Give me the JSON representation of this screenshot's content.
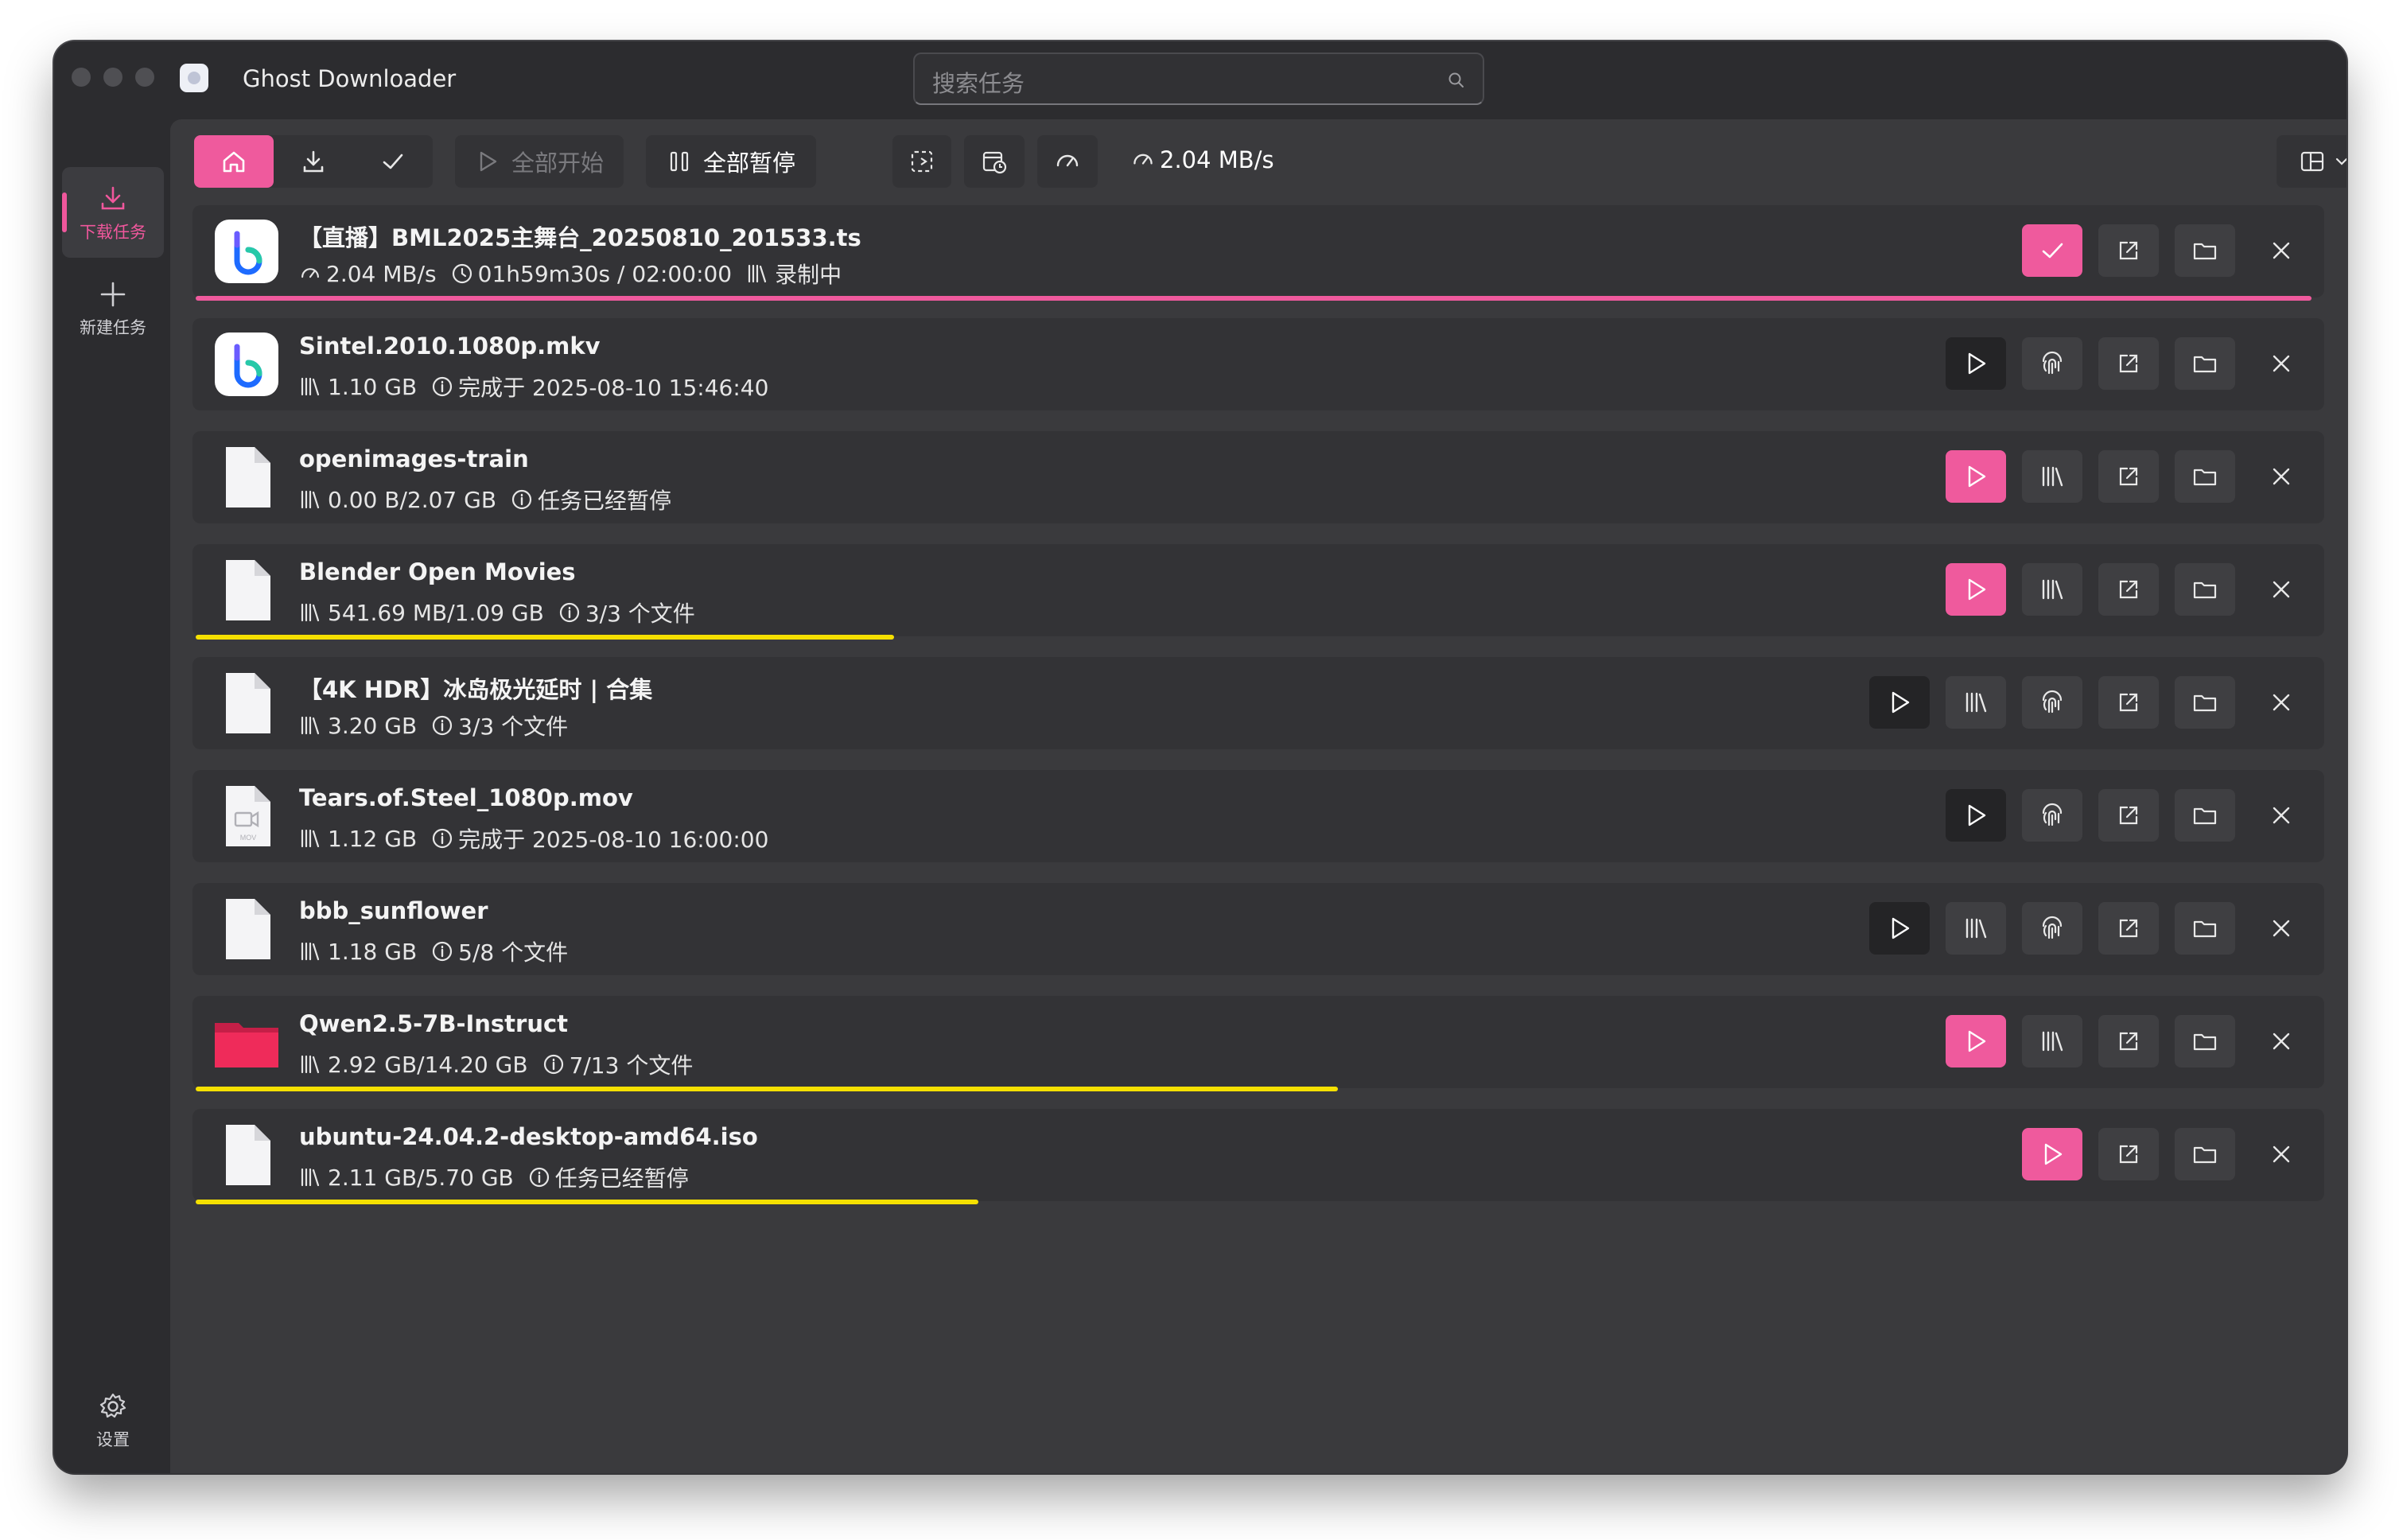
{
  "window": {
    "title": "Ghost Downloader"
  },
  "search": {
    "placeholder": "搜索任务"
  },
  "sidebar": {
    "items": [
      {
        "label": "下载任务",
        "icon": "download-icon",
        "active": true
      },
      {
        "label": "新建任务",
        "icon": "plus-icon",
        "active": false
      }
    ],
    "settings_label": "设置"
  },
  "toolbar": {
    "filters": [
      "all-home-icon",
      "downloading-icon",
      "finished-check-icon"
    ],
    "start_all_label": "全部开始",
    "pause_all_label": "全部暂停",
    "speed": "2.04 MB/s"
  },
  "colors": {
    "accent": "#ef5a9d",
    "progress_yellow": "#f5e000",
    "progress_pink": "#ef5a9d"
  },
  "tasks": [
    {
      "name": "【直播】BML2025主舞台_20250810_201533.ts",
      "icon": "bilibili-icon",
      "meta": [
        "2.04 MB/s",
        "01h59m30s / 02:00:00",
        "录制中"
      ],
      "progress": 1.0,
      "bar": "pink"
    },
    {
      "name": "Sintel.2010.1080p.mkv",
      "icon": "bilibili-icon",
      "meta": [
        "1.10 GB",
        "完成于 2025-08-10 15:46:40"
      ],
      "progress": null
    },
    {
      "name": "openimages-train",
      "icon": "file-icon",
      "meta": [
        "0.00 B/2.07 GB",
        "任务已经暂停"
      ],
      "progress": null
    },
    {
      "name": "Blender Open Movies",
      "icon": "file-icon",
      "meta": [
        "541.69 MB/1.09 GB",
        "3/3 个文件"
      ],
      "progress": 0.33,
      "bar": "yellow"
    },
    {
      "name": "【4K HDR】冰岛极光延时 | 合集",
      "icon": "file-icon",
      "meta": [
        "3.20 GB",
        "3/3 个文件"
      ],
      "progress": null
    },
    {
      "name": "Tears.of.Steel_1080p.mov",
      "icon": "video-file-icon",
      "meta": [
        "1.12 GB",
        "完成于 2025-08-10 16:00:00"
      ],
      "progress": null
    },
    {
      "name": "bbb_sunflower",
      "icon": "file-icon",
      "meta": [
        "1.18 GB",
        "5/8 个文件"
      ],
      "progress": null
    },
    {
      "name": "Qwen2.5-7B-Instruct",
      "icon": "folder-icon",
      "meta": [
        "2.92 GB/14.20 GB",
        "7/13 个文件"
      ],
      "progress": 0.54,
      "bar": "yellow"
    },
    {
      "name": "ubuntu-24.04.2-desktop-amd64.iso",
      "icon": "file-icon",
      "meta": [
        "2.11 GB/5.70 GB",
        "任务已经暂停"
      ],
      "progress": 0.37,
      "bar": "yellow"
    }
  ]
}
